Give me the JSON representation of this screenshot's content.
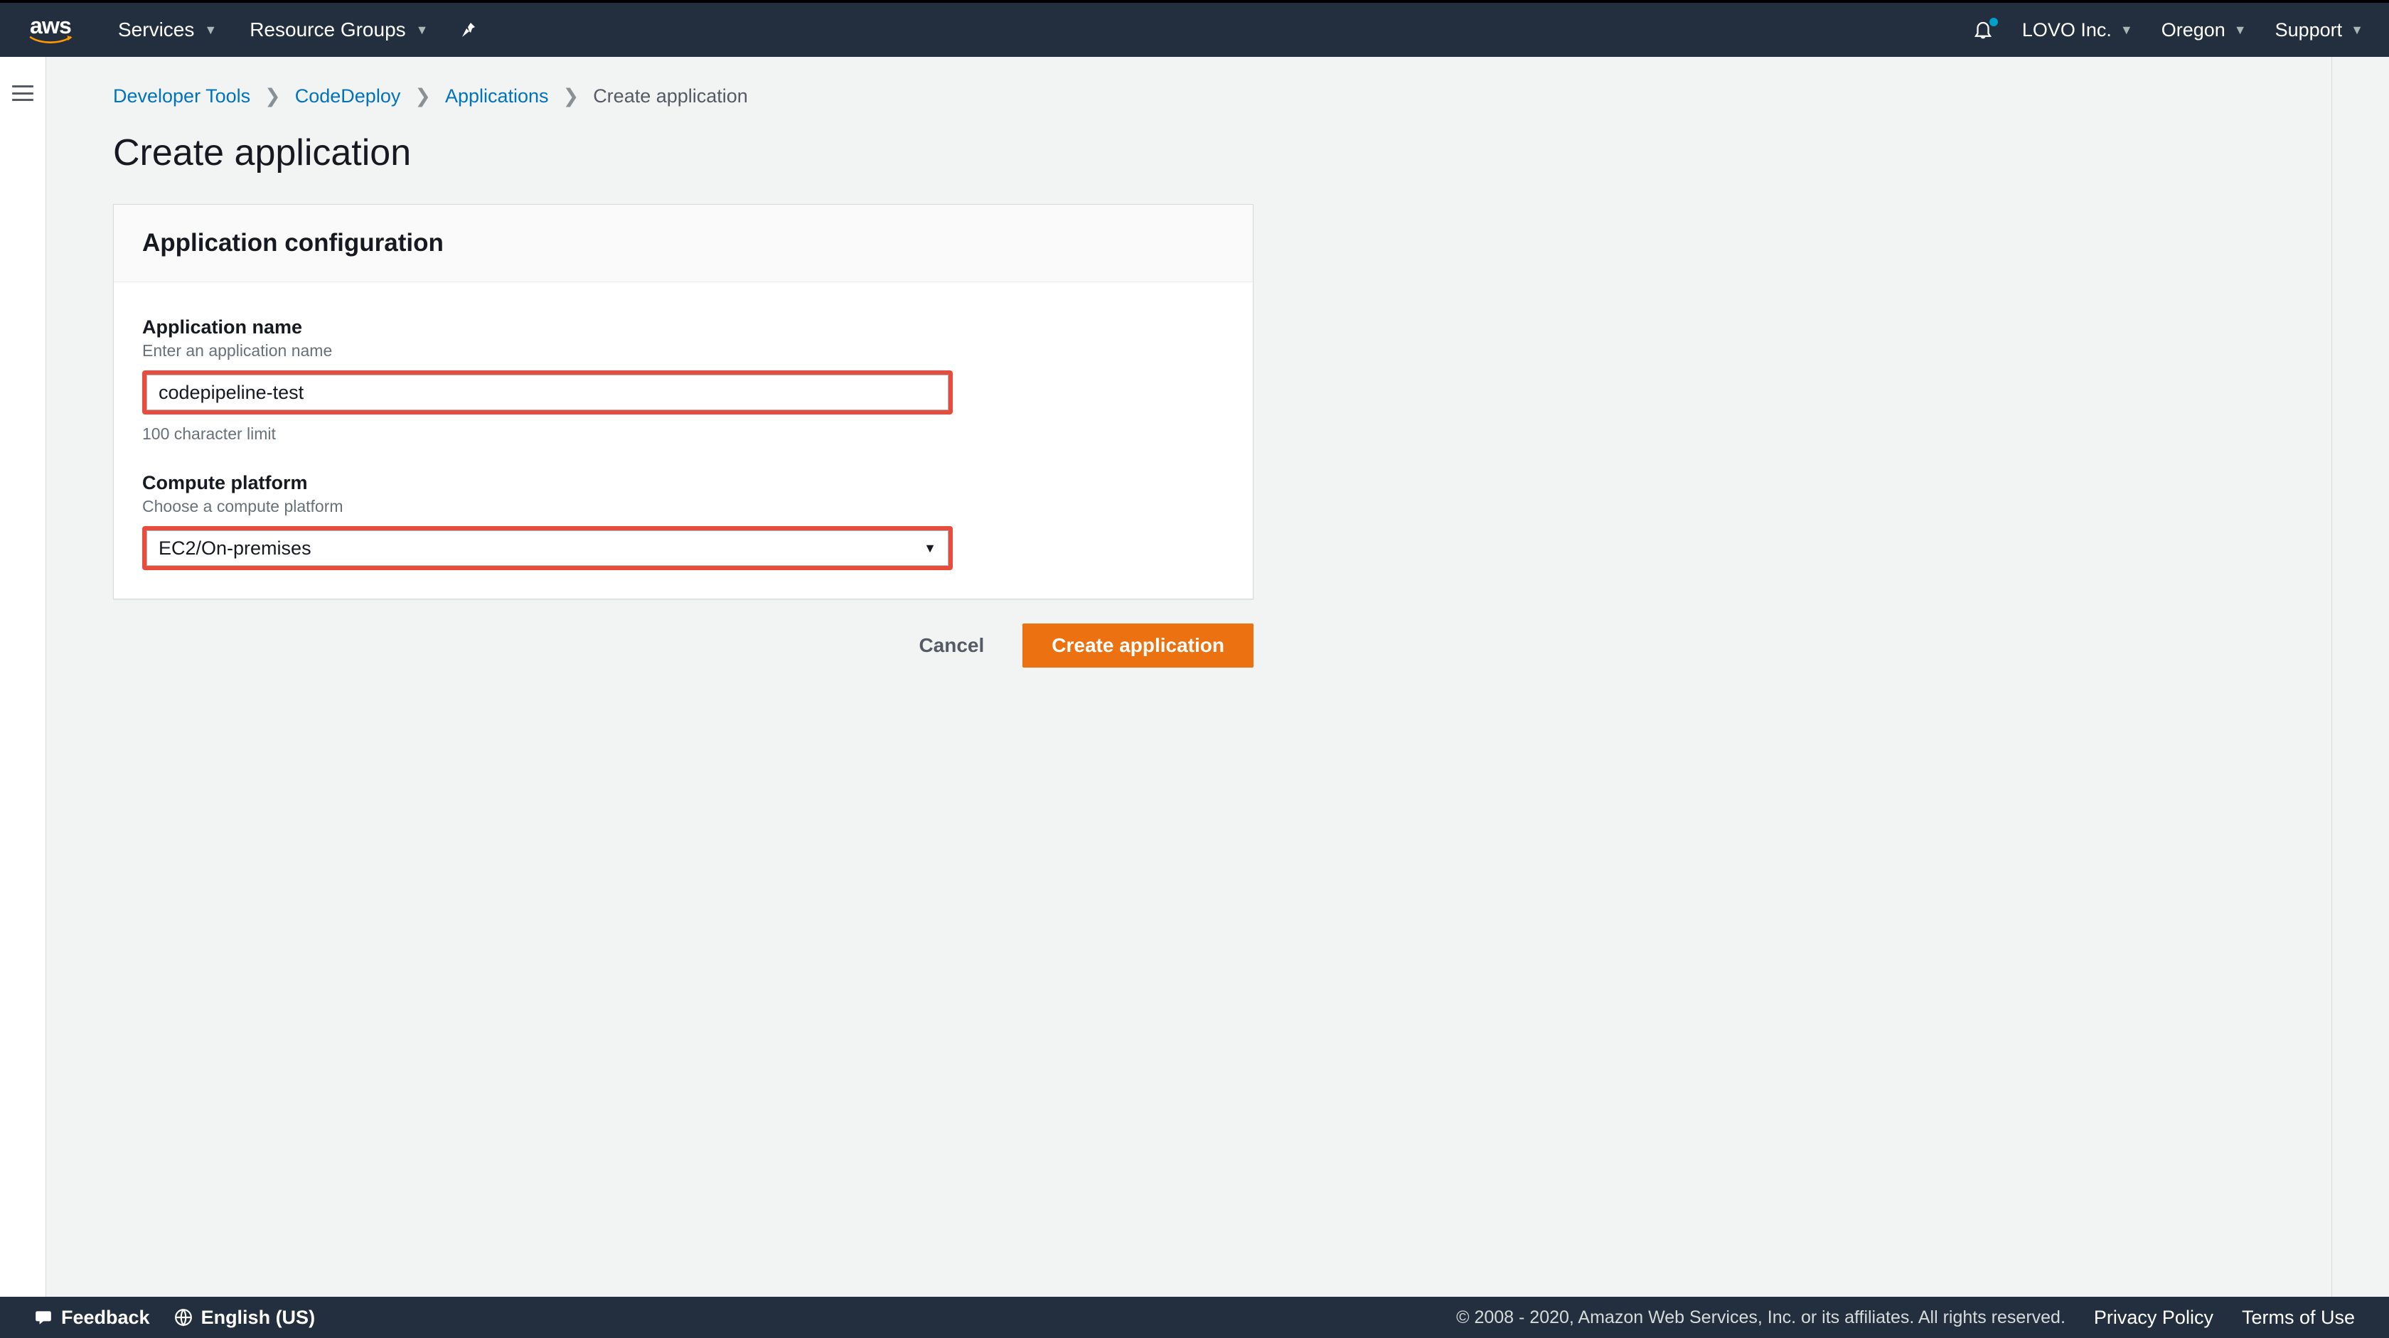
{
  "header": {
    "logo_text": "aws",
    "services_label": "Services",
    "resource_groups_label": "Resource Groups",
    "account_label": "LOVO Inc.",
    "region_label": "Oregon",
    "support_label": "Support"
  },
  "breadcrumb": {
    "items": [
      {
        "label": "Developer Tools",
        "link": true
      },
      {
        "label": "CodeDeploy",
        "link": true
      },
      {
        "label": "Applications",
        "link": true
      },
      {
        "label": "Create application",
        "link": false
      }
    ]
  },
  "page": {
    "title": "Create application"
  },
  "panel": {
    "title": "Application configuration",
    "app_name": {
      "label": "Application name",
      "hint": "Enter an application name",
      "value": "codepipeline-test",
      "bottom_hint": "100 character limit"
    },
    "compute_platform": {
      "label": "Compute platform",
      "hint": "Choose a compute platform",
      "value": "EC2/On-premises"
    }
  },
  "actions": {
    "cancel": "Cancel",
    "create": "Create application"
  },
  "footer": {
    "feedback": "Feedback",
    "language": "English (US)",
    "copyright": "© 2008 - 2020, Amazon Web Services, Inc. or its affiliates. All rights reserved.",
    "privacy": "Privacy Policy",
    "terms": "Terms of Use"
  }
}
